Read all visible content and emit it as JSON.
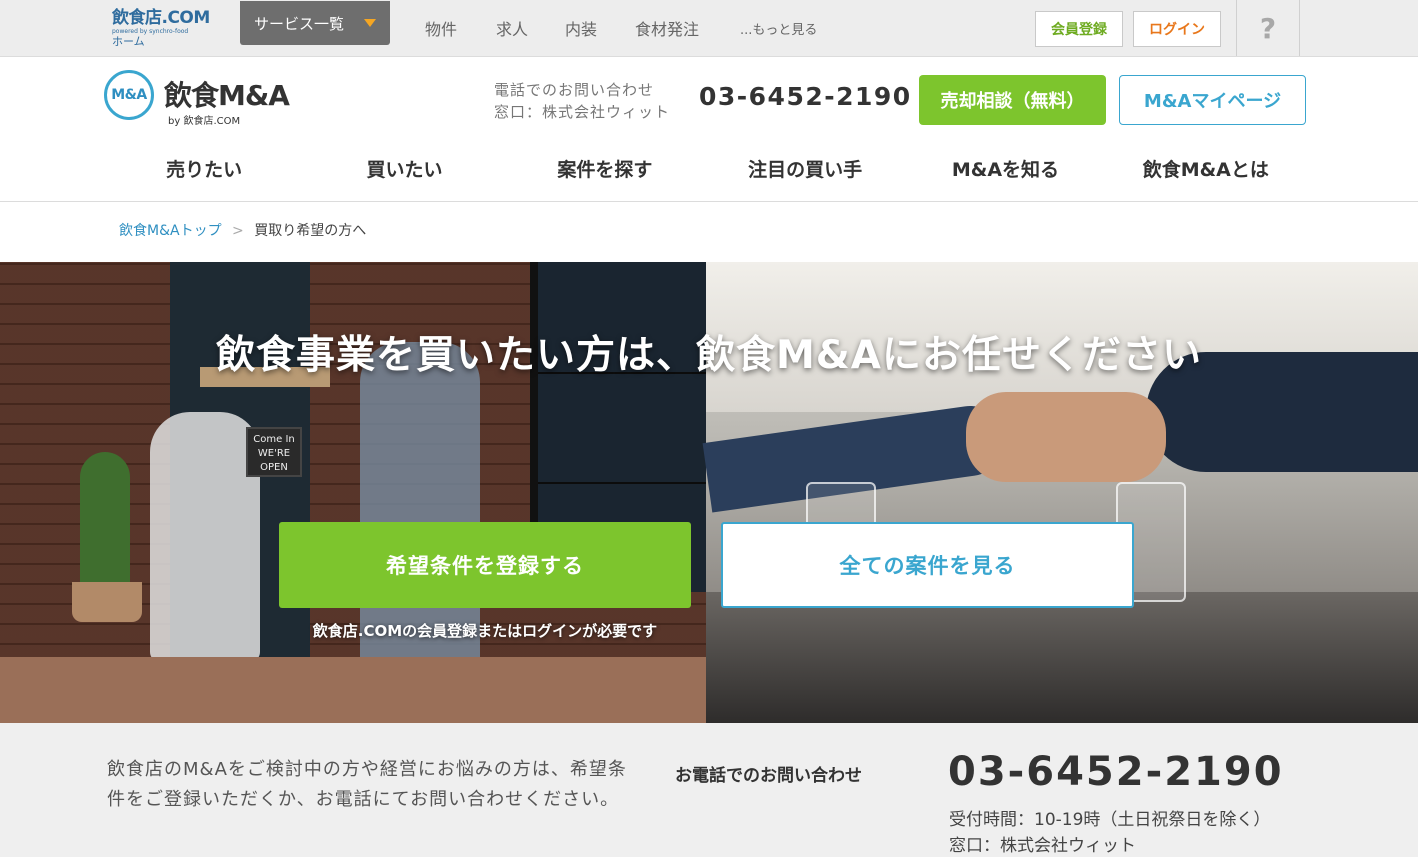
{
  "topbar": {
    "logo_line1": "飲食店.COM",
    "logo_line2": "powered by synchro-food",
    "logo_line3": "ホーム",
    "services_label": "サービス一覧",
    "links": [
      "物件",
      "求人",
      "内装",
      "食材発注",
      "...もっと見る"
    ],
    "register_label": "会員登録",
    "login_label": "ログイン",
    "help_label": "?"
  },
  "header": {
    "brand_mark": "M&A",
    "brand_name": "飲食M&A",
    "brand_by": "by 飲食店.COM",
    "contact_line1": "電話でのお問い合わせ",
    "contact_line2": "窓口：株式会社ウィット",
    "phone": "03-6452-2190",
    "sell_button": "売却相談（無料）",
    "mypage_button": "M&Aマイページ"
  },
  "nav": [
    "売りたい",
    "買いたい",
    "案件を探す",
    "注目の買い手",
    "M&Aを知る",
    "飲食M&Aとは"
  ],
  "breadcrumb": {
    "home": "飲食M&Aトップ",
    "separator": ">",
    "current": "買取り希望の方へ"
  },
  "hero": {
    "title": "飲食事業を買いたい方は、飲食M&Aにお任せください",
    "sign_text": "Come In WE'RE OPEN",
    "primary_button": "希望条件を登録する",
    "secondary_button": "全ての案件を見る",
    "note": "飲食店.COMの会員登録またはログインが必要です"
  },
  "info": {
    "text": "飲食店のM&Aをご検討中の方や経営にお悩みの方は、希望条件をご登録いただくか、お電話にてお問い合わせください。",
    "phone_label": "お電話でのお問い合わせ",
    "phone": "03-6452-2190",
    "hours": "受付時間：10-19時（土日祝祭日を除く）",
    "desk": "窓口：株式会社ウィット"
  },
  "colors": {
    "brand_blue": "#3aa6cf",
    "accent_green": "#7dc52d",
    "login_orange": "#e8771b",
    "topbar_bg": "#ededed",
    "info_bg": "#efefef"
  }
}
